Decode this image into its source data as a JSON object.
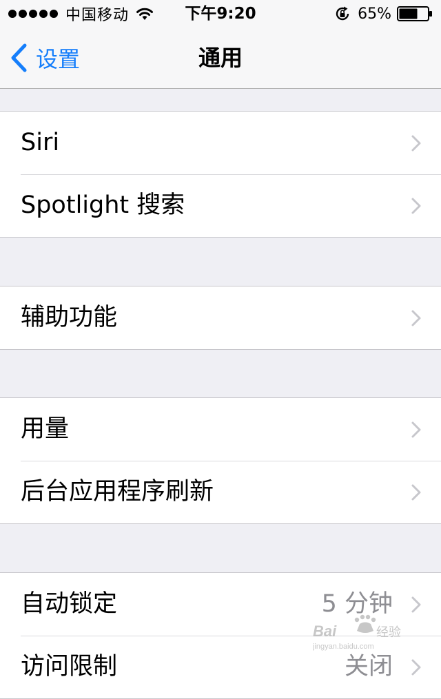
{
  "status_bar": {
    "carrier": "中国移动",
    "time": "下午9:20",
    "battery": "65%",
    "battery_level": 0.65,
    "icons": [
      "signal-dots-icon",
      "wifi-icon",
      "rotation-lock-icon",
      "battery-icon"
    ]
  },
  "nav": {
    "back_label": "设置",
    "title": "通用"
  },
  "sections": [
    {
      "items": [
        {
          "label": "Siri"
        },
        {
          "label": "Spotlight 搜索"
        }
      ]
    },
    {
      "items": [
        {
          "label": "辅助功能"
        }
      ]
    },
    {
      "items": [
        {
          "label": "用量"
        },
        {
          "label": "后台应用程序刷新"
        }
      ]
    },
    {
      "items": [
        {
          "label": "自动锁定",
          "value": "5 分钟"
        },
        {
          "label": "访问限制",
          "value": "关闭"
        }
      ]
    }
  ],
  "colors": {
    "accent": "#157efb",
    "background": "#efeff4",
    "secondary_text": "#8e8e93"
  },
  "watermark": {
    "text": "Baidu经验",
    "subtext": "jingyan.baidu.com"
  }
}
